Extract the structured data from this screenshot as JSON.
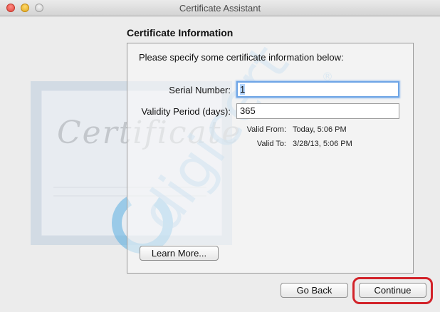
{
  "window": {
    "title": "Certificate Assistant"
  },
  "section": {
    "title": "Certificate Information"
  },
  "panel": {
    "instruction": "Please specify some certificate information below:"
  },
  "fields": {
    "serial_label": "Serial Number:",
    "serial_value": "1",
    "validity_label": "Validity Period (days):",
    "validity_value": "365"
  },
  "validity_info": {
    "from_label": "Valid From:",
    "from_value": "Today, 5:06 PM",
    "to_label": "Valid To:",
    "to_value": "3/28/13, 5:06 PM"
  },
  "background": {
    "certificate_text": "Certificate",
    "brand_text": "digicert",
    "registered_mark": "®"
  },
  "buttons": {
    "learn_more": "Learn More...",
    "go_back": "Go Back",
    "continue": "Continue"
  },
  "colors": {
    "accent_focus": "#6ea5e6",
    "highlight_border": "#d2232a",
    "brand_blue": "#5aaee0"
  }
}
